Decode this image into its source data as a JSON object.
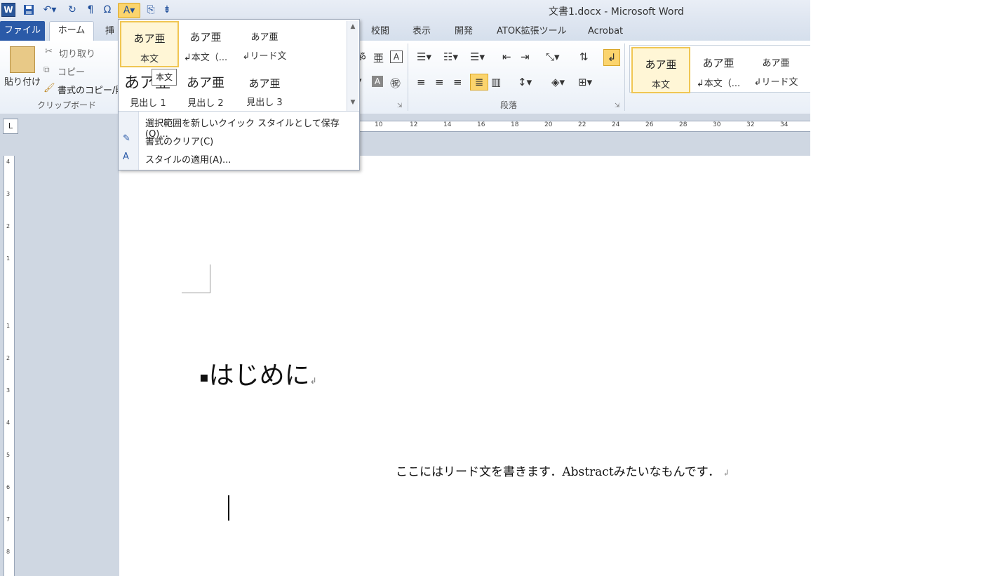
{
  "window": {
    "title": "文書1.docx - Microsoft Word"
  },
  "qat": {
    "word_icon": "W",
    "icons": [
      "save-icon",
      "undo-icon",
      "redo-icon",
      "paragraph-mark-icon",
      "omega-icon",
      "quick-styles-icon",
      "paste-special-icon",
      "customize-qat-icon"
    ]
  },
  "tabs": {
    "file": "ファイル",
    "home": "ホーム",
    "insert": "挿",
    "review": "校閲",
    "view": "表示",
    "developer": "開発",
    "atok": "ATOK拡張ツール",
    "acrobat": "Acrobat"
  },
  "clipboard": {
    "paste": "貼り付け",
    "cut": "切り取り",
    "copy": "コピー",
    "format_painter": "書式のコピー/貼",
    "group": "クリップボード"
  },
  "paragraph": {
    "group": "段落"
  },
  "styles": [
    {
      "sample": "あア亜",
      "name": "本文"
    },
    {
      "sample": "あア亜",
      "name": "↲本文（..."
    },
    {
      "sample": "あア亜",
      "name": "↲リード文"
    }
  ],
  "dropdown": {
    "row1": [
      {
        "sample": "あア亜",
        "name": "本文"
      },
      {
        "sample": "あア亜",
        "name": "↲本文（..."
      },
      {
        "sample": "あア亜",
        "name": "↲リード文"
      }
    ],
    "row2": [
      {
        "sample": "あア亜",
        "name": "見出し 1"
      },
      {
        "sample": "あア亜",
        "name": "見出し 2"
      },
      {
        "sample": "あア亜",
        "name": "見出し 3"
      }
    ],
    "tooltip": "本文",
    "items": [
      {
        "label": "選択範囲を新しいクイック スタイルとして保存(Q)..."
      },
      {
        "label": "書式のクリア(C)"
      },
      {
        "label": "スタイルの適用(A)..."
      }
    ]
  },
  "ruler": {
    "ticks": [
      "10",
      "12",
      "14",
      "16",
      "18",
      "20",
      "22",
      "24",
      "26",
      "28",
      "30",
      "32",
      "34"
    ],
    "vticks": [
      "4",
      "3",
      "2",
      "1",
      "1",
      "2",
      "3",
      "4",
      "5",
      "6",
      "7",
      "8"
    ]
  },
  "document": {
    "heading": "はじめに",
    "lead": "ここにはリード文を書きます．Abstractみたいなもんです．"
  }
}
